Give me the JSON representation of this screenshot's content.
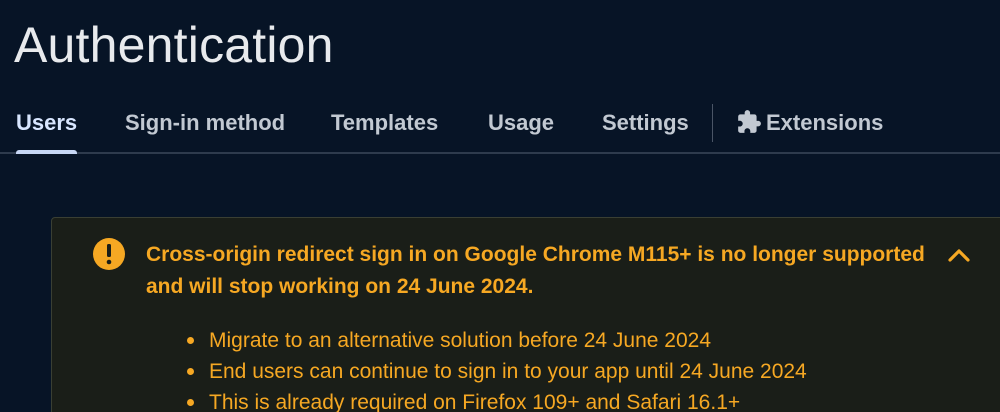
{
  "page": {
    "title": "Authentication"
  },
  "tabs": [
    {
      "label": "Users",
      "active": true
    },
    {
      "label": "Sign-in method",
      "active": false
    },
    {
      "label": "Templates",
      "active": false
    },
    {
      "label": "Usage",
      "active": false
    },
    {
      "label": "Settings",
      "active": false
    },
    {
      "label": "Extensions",
      "active": false,
      "icon": "puzzle-piece-icon"
    }
  ],
  "banner": {
    "severity": "warning",
    "icon": "warning-circle-icon",
    "message": "Cross-origin redirect sign in on Google Chrome M115+ is no longer supported and will stop working on 24 June 2024.",
    "collapse_icon": "chevron-up-icon",
    "bullets": [
      "Migrate to an alternative solution before 24 June 2024",
      "End users can continue to sign in to your app until 24 June 2024",
      "This is already required on Firefox 109+ and Safari 16.1+"
    ]
  },
  "colors": {
    "background": "#071426",
    "warning_text": "#f6a823",
    "banner_background": "#1a1e18",
    "active_tab": "#d8e6ff"
  }
}
